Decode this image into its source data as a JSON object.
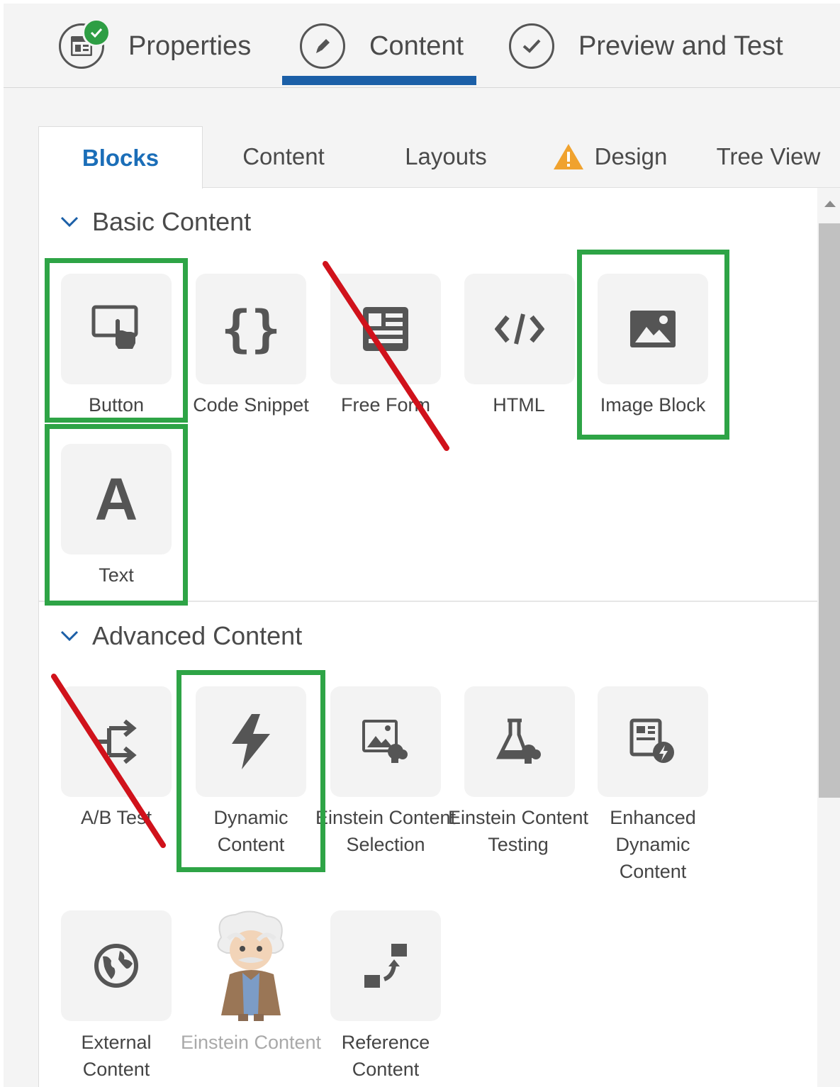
{
  "steps": [
    {
      "label": "Properties",
      "icon": "properties-icon",
      "completed": true
    },
    {
      "label": "Content",
      "icon": "pencil-icon",
      "active": true
    },
    {
      "label": "Preview and Test",
      "icon": "check-circle-icon"
    }
  ],
  "tabs": [
    {
      "label": "Blocks",
      "active": true
    },
    {
      "label": "Content"
    },
    {
      "label": "Layouts"
    },
    {
      "label": "Design",
      "icon": "warning-icon"
    },
    {
      "label": "Tree View"
    }
  ],
  "sections": {
    "basic": {
      "title": "Basic Content",
      "items": [
        {
          "label": "Button",
          "icon": "button-touch-icon"
        },
        {
          "label": "Code Snippet",
          "icon": "braces-icon"
        },
        {
          "label": "Free Form",
          "icon": "free-form-icon"
        },
        {
          "label": "HTML",
          "icon": "html-code-icon"
        },
        {
          "label": "Image Block",
          "icon": "image-icon"
        },
        {
          "label": "Text",
          "icon": "text-a-icon"
        }
      ]
    },
    "advanced": {
      "title": "Advanced Content",
      "items": [
        {
          "label": "A/B Test",
          "icon": "ab-test-icon"
        },
        {
          "label": "Dynamic Content",
          "icon": "lightning-icon"
        },
        {
          "label": "Einstein Content Selection",
          "icon": "einstein-image-icon"
        },
        {
          "label": "Einstein Content Testing",
          "icon": "flask-icon"
        },
        {
          "label": "Enhanced Dynamic Content",
          "icon": "enhanced-dynamic-icon"
        },
        {
          "label": "External Content",
          "icon": "globe-icon"
        },
        {
          "label": "Einstein Content",
          "icon": "einstein-mascot-icon",
          "disabled": true
        },
        {
          "label": "Reference Content",
          "icon": "reference-icon"
        }
      ]
    }
  },
  "colors": {
    "highlight": "#2ea446",
    "strike": "#d0121b",
    "accent": "#1b5fa7",
    "tab_active": "#1b6eb8",
    "icon": "#555555"
  }
}
